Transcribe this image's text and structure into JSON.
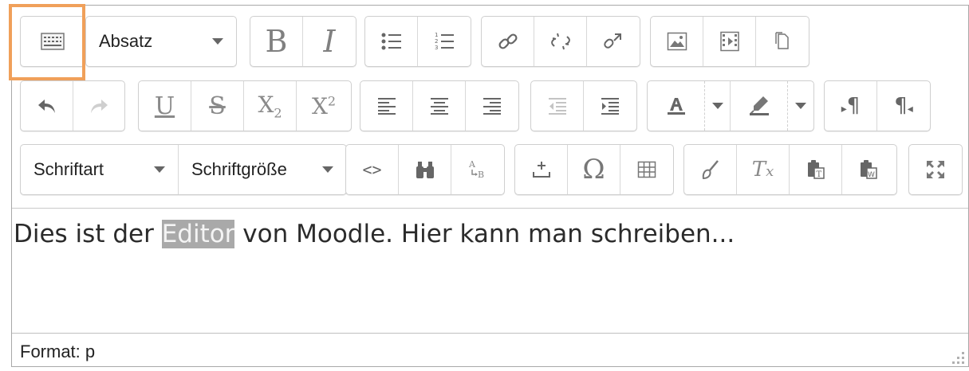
{
  "toolbar": {
    "block_format": "Absatz",
    "font_family": "Schriftart",
    "font_size": "Schriftgröße",
    "bold_glyph": "B",
    "italic_glyph": "I",
    "underline_glyph": "U",
    "strike_glyph": "S",
    "subscript_glyph": "X",
    "subscript_index": "2",
    "superscript_glyph": "X",
    "superscript_index": "2",
    "omega_glyph": "Ω",
    "clear_format_glyph": "T",
    "clear_format_sub": "x",
    "code_glyph": "<>",
    "pilcrow_glyph": "¶"
  },
  "content": {
    "before": "Dies ist der ",
    "selected": "Editor",
    "after": " von Moodle. Hier kann man schreiben..."
  },
  "status": {
    "text": "Format: p"
  },
  "colors": {
    "highlight_border": "#f0a05a",
    "selection_bg": "#a9a9a9"
  }
}
